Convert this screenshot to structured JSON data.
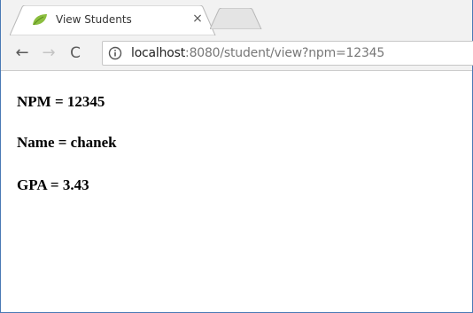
{
  "tab": {
    "title": "View Students",
    "close_label": "×"
  },
  "toolbar": {
    "back_label": "←",
    "forward_label": "→",
    "reload_label": "C"
  },
  "address_bar": {
    "host": "localhost",
    "rest": ":8080/student/view?npm=12345"
  },
  "student": {
    "npm_line": "NPM = 12345",
    "name_line": "Name = chanek",
    "gpa_line": "GPA = 3.43"
  },
  "icons": {
    "favicon": "spring-leaf-icon",
    "info": "info-icon",
    "back": "arrow-left-icon",
    "forward": "arrow-right-icon",
    "reload": "reload-icon"
  },
  "colors": {
    "favicon_green": "#8bbe3f",
    "window_border": "#4a7ab5",
    "chrome_bg": "#f2f2f2"
  }
}
